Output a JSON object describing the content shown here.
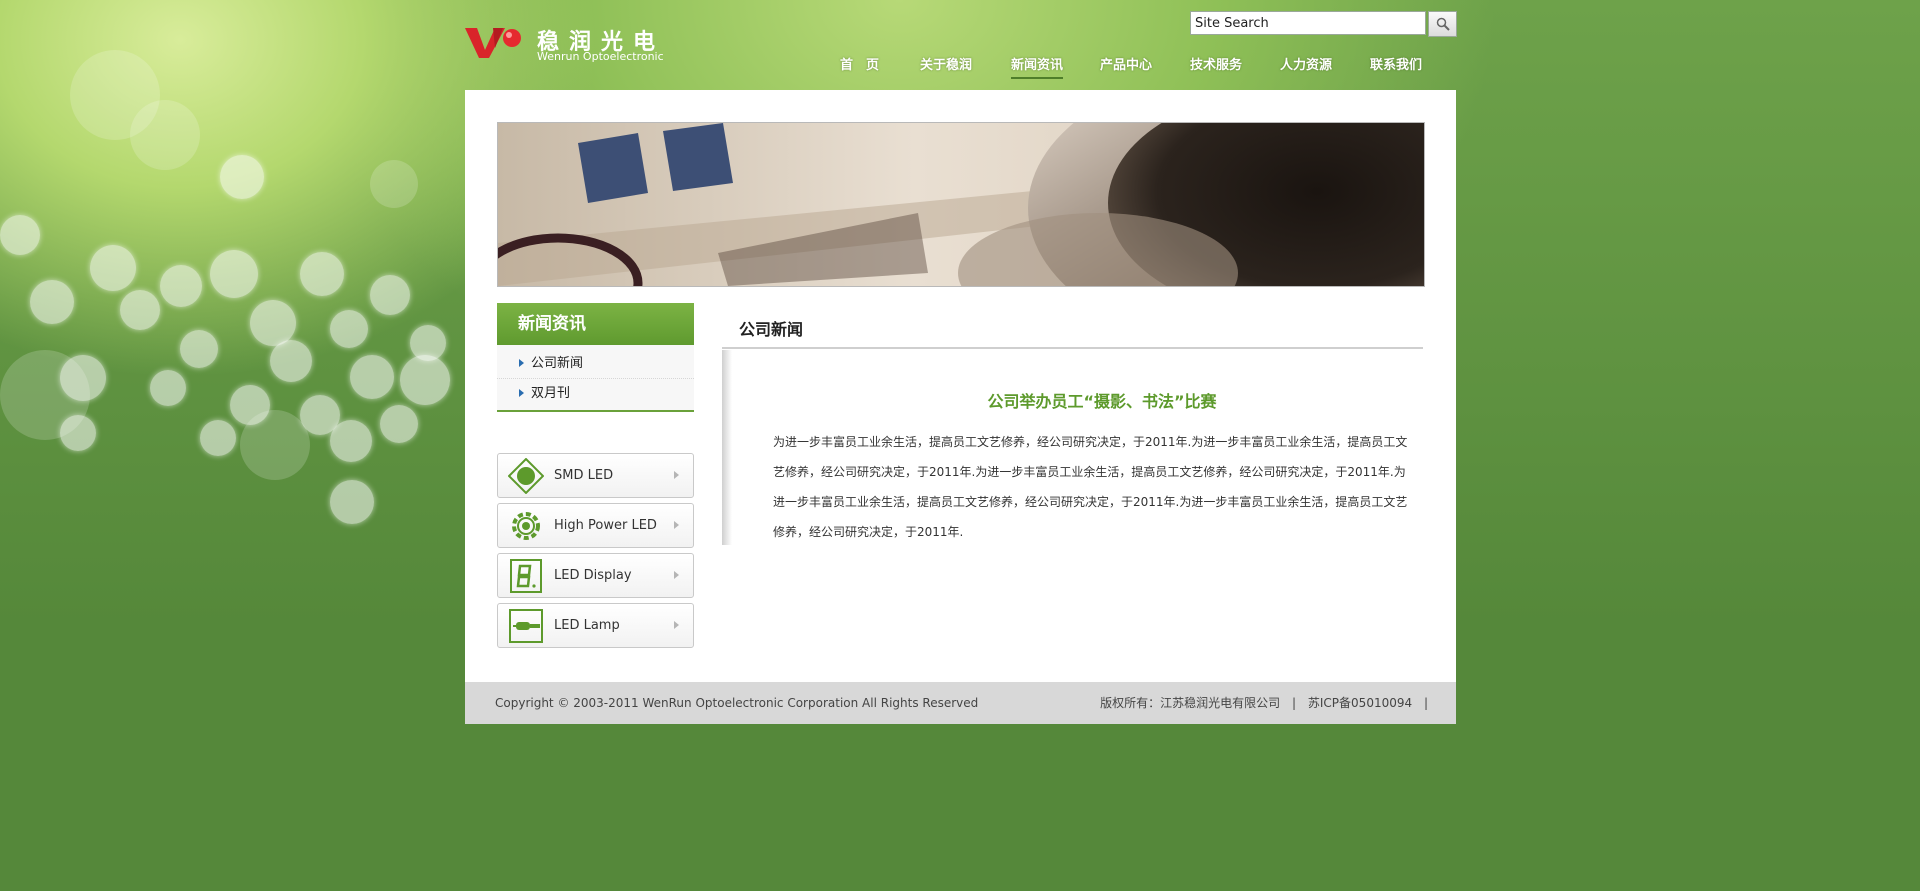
{
  "brand": {
    "name_cn": "稳润光电",
    "name_en": "Wenrun Optoelectronic",
    "logo_color": "#d9242a",
    "accent_color": "#5d9a2c"
  },
  "search": {
    "value": "Site Search",
    "icon": "search-icon"
  },
  "nav": {
    "items": [
      {
        "label": "首　页"
      },
      {
        "label": "关于稳润"
      },
      {
        "label": "新闻资讯"
      },
      {
        "label": "产品中心"
      },
      {
        "label": "技术服务"
      },
      {
        "label": "人力资源"
      },
      {
        "label": "联系我们"
      }
    ],
    "active": "新闻资讯"
  },
  "sidebar": {
    "title": "新闻资讯",
    "items": [
      {
        "label": "公司新闻"
      },
      {
        "label": "双月刊"
      }
    ]
  },
  "products": [
    {
      "label": "SMD LED",
      "icon": "smd-led-icon"
    },
    {
      "label": "High Power LED",
      "icon": "high-power-led-icon"
    },
    {
      "label": "LED Display",
      "icon": "led-display-icon"
    },
    {
      "label": "LED Lamp",
      "icon": "led-lamp-icon"
    }
  ],
  "content": {
    "section_title": "公司新闻",
    "article_title": "公司举办员工“摄影、书法”比赛",
    "article_body": "为进一步丰富员工业余生活，提高员工文艺修养，经公司研究决定，于2011年.为进一步丰富员工业余生活，提高员工文艺修养，经公司研究决定，于2011年.为进一步丰富员工业余生活，提高员工文艺修养，经公司研究决定，于2011年.为进一步丰富员工业余生活，提高员工文艺修养，经公司研究决定，于2011年.为进一步丰富员工业余生活，提高员工文艺修养，经公司研究决定，于2011年."
  },
  "footer": {
    "copyright": "Copyright © 2003-2011 WenRun Optoelectronic Corporation All Rights Reserved",
    "owner": "版权所有：江苏稳润光电有限公司",
    "separator": "|",
    "icp": "苏ICP备05010094"
  }
}
